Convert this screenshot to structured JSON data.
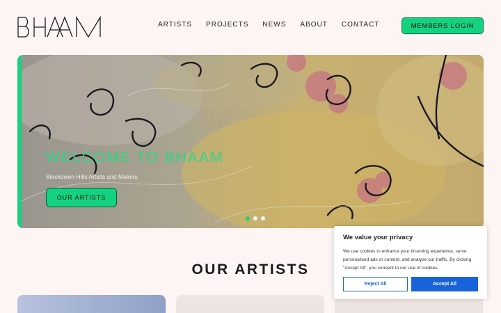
{
  "header": {
    "logo_text": "BHAAM",
    "nav": [
      "ARTISTS",
      "PROJECTS",
      "NEWS",
      "ABOUT",
      "CONTACT"
    ],
    "members_login": "MEMBERS LOGIN"
  },
  "hero": {
    "title": "WELCOME TO BHAAM",
    "subtitle": "Blackdown Hills Artists and Makers",
    "button": "OUR ARTISTS",
    "slide_count": 3,
    "active_slide": 1
  },
  "section": {
    "title": "OUR ARTISTS"
  },
  "cookie": {
    "title": "We value your privacy",
    "text": "We use cookies to enhance your browsing experience, serve personalised ads or content, and analyse our traffic. By clicking \"Accept All\", you consent to our use of cookies.",
    "reject": "Reject All",
    "accept": "Accept All"
  },
  "colors": {
    "accent": "#14d37f",
    "background": "#fdf5f3",
    "cookie_button": "#1863dc"
  }
}
